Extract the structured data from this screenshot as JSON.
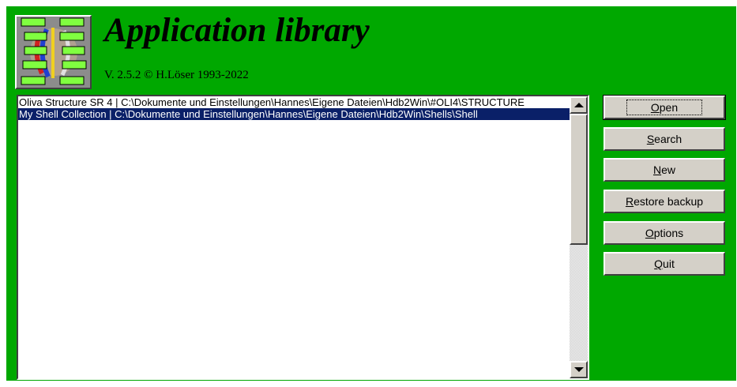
{
  "app": {
    "title": "Application library",
    "version": "V. 2.5.2 © H.Löser 1993-2022"
  },
  "colors": {
    "background": "#00a800",
    "selection": "#0a2068",
    "button_face": "#d4d0c8"
  },
  "libraries": [
    {
      "label": "Oliva Structure SR 4 | C:\\Dokumente und Einstellungen\\Hannes\\Eigene Dateien\\Hdb2Win\\#OLI4\\STRUCTURE",
      "selected": false
    },
    {
      "label": "My Shell Collection | C:\\Dokumente und Einstellungen\\Hannes\\Eigene Dateien\\Hdb2Win\\Shells\\Shell",
      "selected": true
    }
  ],
  "buttons": {
    "open": {
      "accel": "O",
      "rest": "pen"
    },
    "search": {
      "accel": "S",
      "rest": "earch"
    },
    "new": {
      "accel": "N",
      "rest": "ew"
    },
    "restore": {
      "accel": "R",
      "rest": "estore backup"
    },
    "options": {
      "accel": "O",
      "rest": "ptions"
    },
    "quit": {
      "accel": "Q",
      "rest": "uit"
    }
  },
  "icons": {
    "logo": "application-library-logo",
    "scroll_up": "arrow-up-icon",
    "scroll_down": "arrow-down-icon"
  }
}
